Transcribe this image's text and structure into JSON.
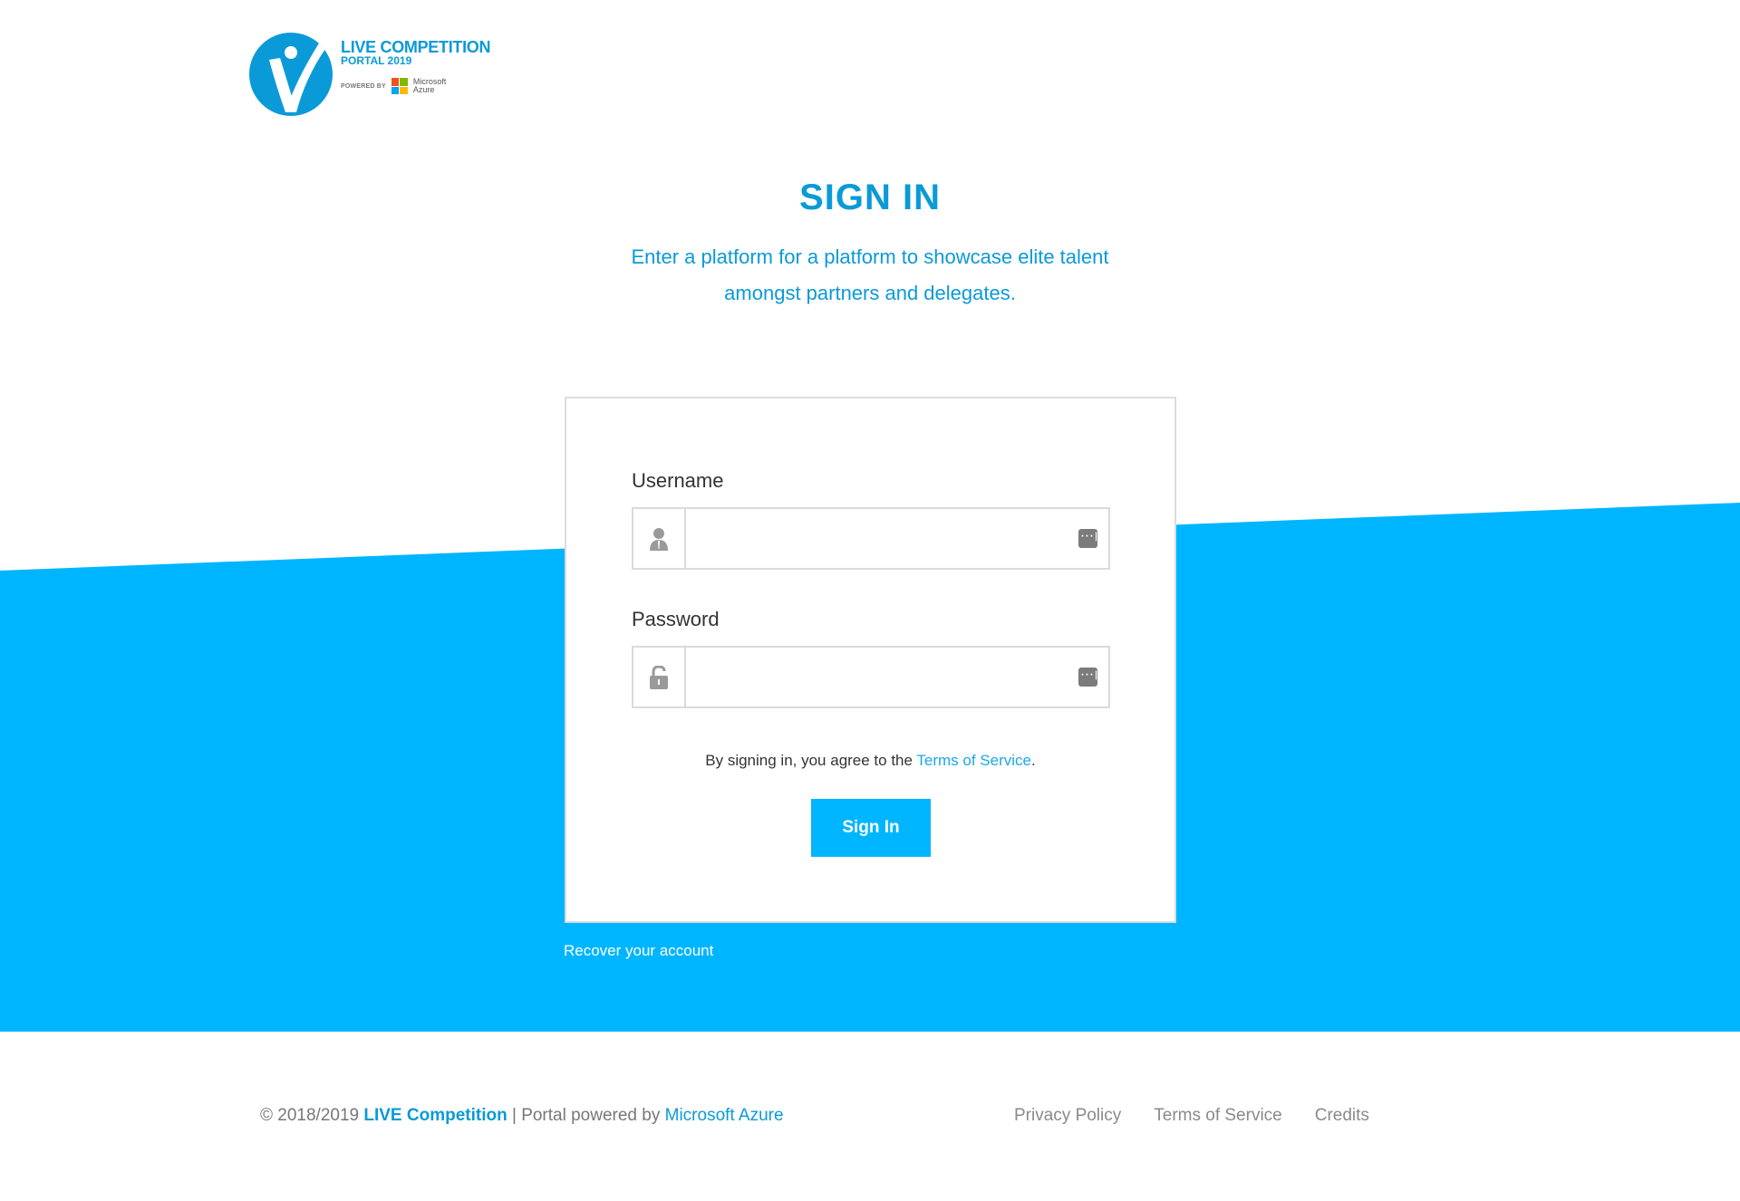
{
  "colors": {
    "brand": "#0a9ad7",
    "band": "#00b5ff",
    "button": "#00b5ff"
  },
  "logo": {
    "title": "LIVE COMPETITION",
    "subtitle": "PORTAL 2019",
    "powered_by": "POWERED BY",
    "partner": "Microsoft\nAzure"
  },
  "heading": "SIGN IN",
  "subheading": "Enter a platform for a platform to showcase elite talent amongst partners and delegates.",
  "form": {
    "username_label": "Username",
    "username_value": "",
    "username_icon": "user-icon",
    "password_label": "Password",
    "password_value": "",
    "password_icon": "unlock-icon",
    "agree_prefix": "By signing in, you agree to the ",
    "agree_link": "Terms of Service",
    "agree_suffix": ".",
    "submit": "Sign In"
  },
  "recover": "Recover your account",
  "footer": {
    "copyright": "© 2018/2019 ",
    "brand": "LIVE Competition",
    "middle": " | Portal powered by ",
    "azure": "Microsoft Azure",
    "links": [
      "Privacy Policy",
      "Terms of Service",
      "Credits"
    ]
  }
}
